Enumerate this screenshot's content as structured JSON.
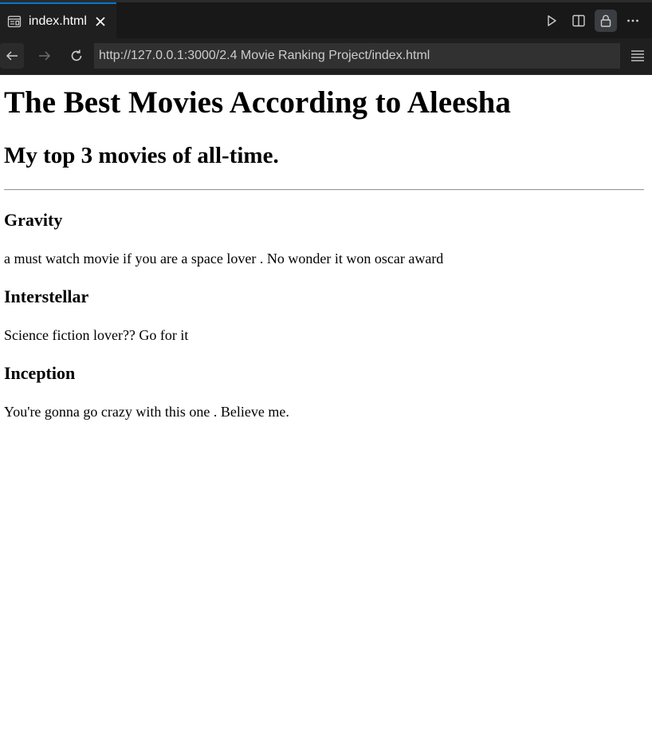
{
  "tab": {
    "title": "index.html",
    "icon": "preview-icon",
    "close_icon": "close-icon"
  },
  "toolbar": {
    "actions": [
      {
        "name": "run-icon"
      },
      {
        "name": "split-editor-icon"
      },
      {
        "name": "lock-icon"
      },
      {
        "name": "more-actions-icon"
      }
    ]
  },
  "address_bar": {
    "url": "http://127.0.0.1:3000/2.4 Movie Ranking Project/index.html"
  },
  "page": {
    "heading": "The Best Movies According to Aleesha",
    "subheading": "My top 3 movies of all-time.",
    "movies": [
      {
        "title": "Gravity",
        "description": "a must watch movie if you are a space lover . No wonder it won oscar award"
      },
      {
        "title": "Interstellar",
        "description": "Science fiction lover?? Go for it"
      },
      {
        "title": "Inception",
        "description": "You're gonna go crazy with this one . Believe me."
      }
    ]
  },
  "colors": {
    "chrome_bg": "#181818",
    "tab_accent": "#0078d4",
    "url_bg": "#313131"
  }
}
